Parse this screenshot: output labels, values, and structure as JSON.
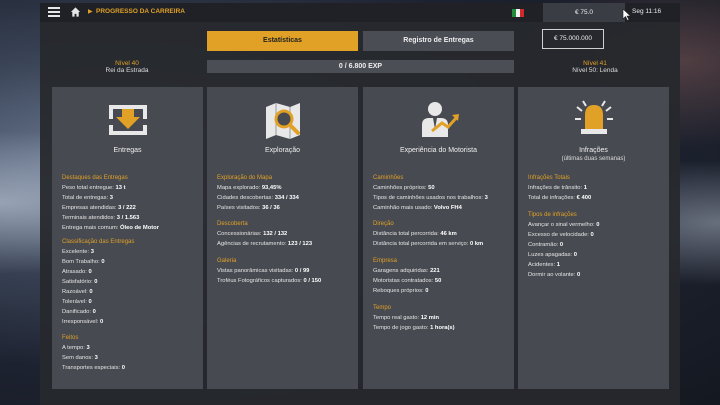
{
  "topbar": {
    "breadcrumb": "PROGRESSO DA CARREIRA",
    "money": "€ 75.0",
    "clock": "Seg 11:16"
  },
  "tabs": {
    "stats": "Estatísticas",
    "log": "Registro de Entregas"
  },
  "money_box": "€ 75.000.000",
  "xp": "0 / 6.800 EXP",
  "level_left": {
    "level": "Nível 40",
    "title": "Rei da Estrada"
  },
  "level_right": {
    "level": "Nível 41",
    "title": "Nível 50: Lenda"
  },
  "cards": {
    "deliveries": {
      "title": "Entregas",
      "sections": [
        {
          "header": "Destaques das Entregas",
          "rows": [
            {
              "label": "Peso total entregue:",
              "value": "13 t"
            },
            {
              "label": "Total de entregas:",
              "value": "3"
            },
            {
              "label": "Empresas atendidas:",
              "value": "3 / 222"
            },
            {
              "label": "Terminais atendidos:",
              "value": "3 / 1.563"
            },
            {
              "label": "Entrega mais comum:",
              "value": "Óleo de Motor"
            }
          ]
        },
        {
          "header": "Classificação das Entregas",
          "rows": [
            {
              "label": "Excelente:",
              "value": "3"
            },
            {
              "label": "Bom Trabalho:",
              "value": "0"
            },
            {
              "label": "Atrasado:",
              "value": "0"
            },
            {
              "label": "Satisfatório:",
              "value": "0"
            },
            {
              "label": "Razoável:",
              "value": "0"
            },
            {
              "label": "Tolerável:",
              "value": "0"
            },
            {
              "label": "Danificado:",
              "value": "0"
            },
            {
              "label": "Irresponsável:",
              "value": "0"
            }
          ]
        },
        {
          "header": "Feitos",
          "rows": [
            {
              "label": "A tempo:",
              "value": "3"
            },
            {
              "label": "Sem danos:",
              "value": "3"
            },
            {
              "label": "Transportes especiais:",
              "value": "0"
            }
          ]
        }
      ]
    },
    "exploration": {
      "title": "Exploração",
      "sections": [
        {
          "header": "Exploração do Mapa",
          "rows": [
            {
              "label": "Mapa explorado:",
              "value": "93,45%"
            },
            {
              "label": "Cidades descobertas:",
              "value": "334 / 334"
            },
            {
              "label": "Países visitados:",
              "value": "36 / 36"
            }
          ]
        },
        {
          "header": "Descoberta",
          "rows": [
            {
              "label": "Concessionárias:",
              "value": "132 / 132"
            },
            {
              "label": "Agências de recrutamento:",
              "value": "123 / 123"
            }
          ]
        },
        {
          "header": "Galeria",
          "rows": [
            {
              "label": "Vistas panorâmicas visitadas:",
              "value": "0 / 99"
            },
            {
              "label": "Troféus Fotográficos capturados:",
              "value": "0 / 150"
            }
          ]
        }
      ]
    },
    "driver": {
      "title": "Experiência do Motorista",
      "sections": [
        {
          "header": "Caminhões",
          "rows": [
            {
              "label": "Caminhões próprios:",
              "value": "50"
            },
            {
              "label": "Tipos de caminhões usados nos trabalhos:",
              "value": "3"
            },
            {
              "label": "Caminhão mais usado:",
              "value": "Volvo FH4"
            }
          ]
        },
        {
          "header": "Direção",
          "rows": [
            {
              "label": "Distância total percorrida:",
              "value": "46 km"
            },
            {
              "label": "Distância total percorrida em serviço:",
              "value": "0 km"
            }
          ]
        },
        {
          "header": "Empresa",
          "rows": [
            {
              "label": "Garagens adquiridas:",
              "value": "221"
            },
            {
              "label": "Motoristas contratados:",
              "value": "50"
            },
            {
              "label": "Reboques próprios:",
              "value": "0"
            }
          ]
        },
        {
          "header": "Tempo",
          "rows": [
            {
              "label": "Tempo real gasto:",
              "value": "12 min"
            },
            {
              "label": "Tempo de jogo gasto:",
              "value": "1 hora(s)"
            }
          ]
        }
      ]
    },
    "infractions": {
      "title": "Infrações",
      "subtitle": "(últimas duas semanas)",
      "sections": [
        {
          "header": "Infrações Totais",
          "rows": [
            {
              "label": "Infrações de trânsito:",
              "value": "1"
            },
            {
              "label": "Total de infrações:",
              "value": "€ 400"
            }
          ]
        },
        {
          "header": "Tipos de infrações",
          "rows": [
            {
              "label": "Avançar o sinal vermelho:",
              "value": "0"
            },
            {
              "label": "Excesso de velocidade:",
              "value": "0"
            },
            {
              "label": "Contramão:",
              "value": "0"
            },
            {
              "label": "Luzes apagadas:",
              "value": "0"
            },
            {
              "label": "Acidentes:",
              "value": "1"
            },
            {
              "label": "Dormir ao volante:",
              "value": "0"
            }
          ]
        }
      ]
    }
  },
  "colors": {
    "accent": "#e1a126",
    "card": "#474a51",
    "panel": "#26282d"
  }
}
